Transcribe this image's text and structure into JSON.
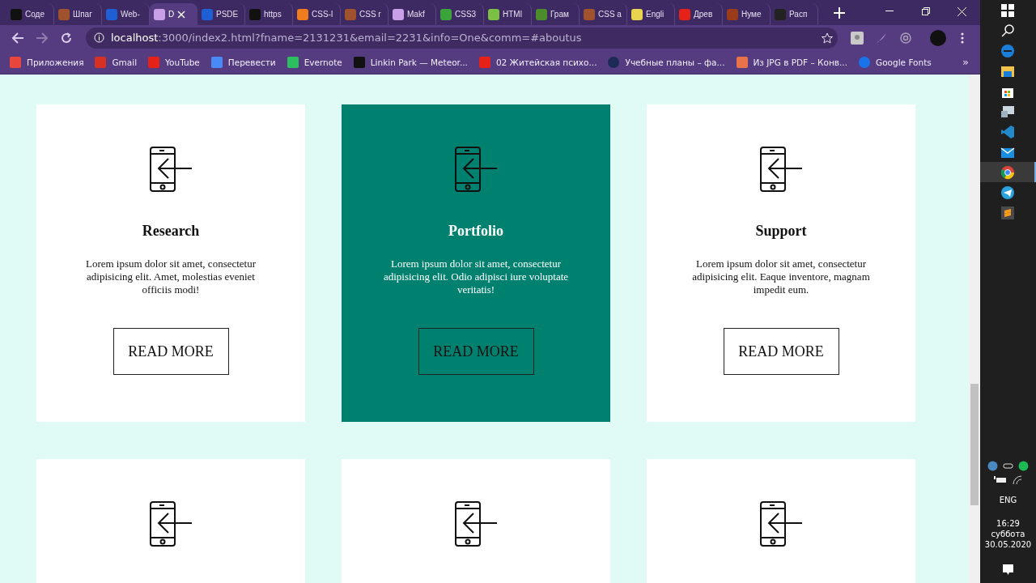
{
  "browser": {
    "tabs": [
      {
        "label": "Соде",
        "selected": false,
        "color": "#111111"
      },
      {
        "label": "Шпаг",
        "selected": false,
        "color": "#a0522d"
      },
      {
        "label": "Web-",
        "selected": false,
        "color": "#1f5fd6"
      },
      {
        "label": "D",
        "selected": true,
        "color": "#c9a0e8"
      },
      {
        "label": "PSDE",
        "selected": false,
        "color": "#1f5fd6"
      },
      {
        "label": "https",
        "selected": false,
        "color": "#111111"
      },
      {
        "label": "CSS-l",
        "selected": false,
        "color": "#f07c1e"
      },
      {
        "label": "CSS r",
        "selected": false,
        "color": "#a0522d"
      },
      {
        "label": "Makf",
        "selected": false,
        "color": "#c9a0e8"
      },
      {
        "label": "CSS3",
        "selected": false,
        "color": "#3aa33a"
      },
      {
        "label": "HTMl",
        "selected": false,
        "color": "#7cc043"
      },
      {
        "label": "Грам",
        "selected": false,
        "color": "#4c8c2b"
      },
      {
        "label": "CSS a",
        "selected": false,
        "color": "#a0522d"
      },
      {
        "label": "Engli",
        "selected": false,
        "color": "#e8d44d"
      },
      {
        "label": "Древ",
        "selected": false,
        "color": "#e62117"
      },
      {
        "label": "Нуме",
        "selected": false,
        "color": "#9a3b1b"
      },
      {
        "label": "Расп",
        "selected": false,
        "color": "#222222"
      }
    ],
    "address": {
      "host": "localhost",
      "path": ":3000/index2.html?fname=2131231&email=2231&info=One&comm=#aboutus"
    },
    "bookmarks": [
      {
        "label": "Приложения",
        "color": "#e8453c"
      },
      {
        "label": "Gmail",
        "color": "#d93025"
      },
      {
        "label": "YouTube",
        "color": "#e62117"
      },
      {
        "label": "Перевести",
        "color": "#4a8af4"
      },
      {
        "label": "Evernote",
        "color": "#2dbe60"
      },
      {
        "label": "Linkin Park — Meteor...",
        "color": "#111111"
      },
      {
        "label": "02 Житейская психо...",
        "color": "#e62117"
      },
      {
        "label": "Учебные планы – фа...",
        "color": "#1d2a55"
      },
      {
        "label": "Из JPG в PDF – Конв...",
        "color": "#e8734a"
      },
      {
        "label": "Google Fonts",
        "color": "#1a73e8"
      }
    ],
    "more_bookmarks": "»"
  },
  "cards": [
    {
      "title": "Research",
      "text": "Lorem ipsum dolor sit amet, consectetur adipisicing elit. Amet, molestias eveniet officiis modi!",
      "button": "READ MORE",
      "selected": false
    },
    {
      "title": "Portfolio",
      "text": "Lorem ipsum dolor sit amet, consectetur adipisicing elit. Odio adipisci iure voluptate veritatis!",
      "button": "READ MORE",
      "selected": true
    },
    {
      "title": "Support",
      "text": "Lorem ipsum dolor sit amet, consectetur adipisicing elit. Eaque inventore, magnam impedit eum.",
      "button": "READ MORE",
      "selected": false
    },
    {
      "selected": false
    },
    {
      "selected": false
    },
    {
      "selected": false
    }
  ],
  "taskbar": {
    "apps": [
      {
        "kind": "start",
        "selected": false
      },
      {
        "kind": "search",
        "selected": false
      },
      {
        "kind": "edge",
        "selected": false
      },
      {
        "kind": "folder",
        "selected": false
      },
      {
        "kind": "store",
        "selected": false
      },
      {
        "kind": "monitor",
        "selected": false
      },
      {
        "kind": "vscode",
        "selected": false
      },
      {
        "kind": "mail",
        "selected": false
      },
      {
        "kind": "chrome",
        "selected": true
      },
      {
        "kind": "telegram",
        "selected": false
      },
      {
        "kind": "sublime",
        "selected": false
      }
    ],
    "language": "ENG",
    "time": "16:29",
    "weekday": "суббота",
    "date": "30.05.2020"
  }
}
